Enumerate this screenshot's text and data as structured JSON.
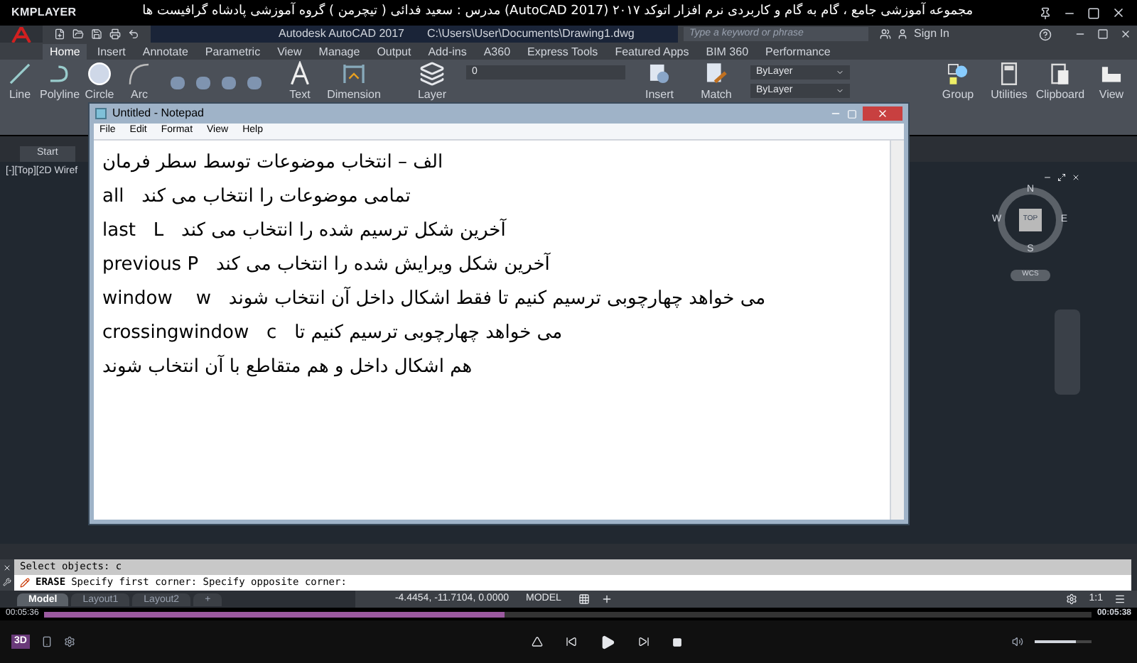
{
  "player": {
    "brand": "KMPLAYER",
    "title": "مجموعه آموزشی جامع ، گام به گام و کاربردی نرم افزار  اتوکد ۲۰۱۷ (AutoCAD 2017)  مدرس : سعید فدائی ( تیچرمن ) گروه آموزشی پادشاه گرافیست ها",
    "time_elapsed": "00:05:36",
    "time_total": "00:05:38",
    "progress": {
      "level": 0.44
    },
    "volume": {
      "level": 0.72
    },
    "badge": "3D"
  },
  "app": {
    "title": "Autodesk AutoCAD 2017",
    "path": "C:\\Users\\User\\Documents\\Drawing1.dwg",
    "search": {
      "placeholder": "Type a keyword or phrase"
    },
    "sign_in": "Sign In"
  },
  "ribbon_tabs": [
    {
      "label": "Home",
      "selected": true
    },
    {
      "label": "Insert",
      "selected": false
    },
    {
      "label": "Annotate",
      "selected": false
    },
    {
      "label": "Parametric",
      "selected": false
    },
    {
      "label": "View",
      "selected": false
    },
    {
      "label": "Manage",
      "selected": false
    },
    {
      "label": "Output",
      "selected": false
    },
    {
      "label": "Add-ins",
      "selected": false
    },
    {
      "label": "A360",
      "selected": false
    },
    {
      "label": "Express Tools",
      "selected": false
    },
    {
      "label": "Featured Apps",
      "selected": false
    },
    {
      "label": "BIM 360",
      "selected": false
    },
    {
      "label": "Performance",
      "selected": false
    }
  ],
  "ribbon_tools_left": [
    {
      "label": "Line",
      "kind": "line"
    },
    {
      "label": "Polyline",
      "kind": "polyline"
    },
    {
      "label": "Circle",
      "kind": "circle"
    },
    {
      "label": "Arc",
      "kind": "arc"
    }
  ],
  "ribbon_tools_mid": [
    {
      "label": "Text",
      "kind": "text"
    },
    {
      "label": "Dimension",
      "kind": "dimension"
    },
    {
      "label": "Layer",
      "kind": "layer"
    }
  ],
  "layer_value": "0",
  "ribbon_tools_right": [
    {
      "label": "Insert",
      "kind": "insert"
    },
    {
      "label": "Match",
      "kind": "match"
    }
  ],
  "properties": [
    "ByLayer",
    "ByLayer"
  ],
  "ribbon_tools_end": [
    {
      "label": "Group",
      "kind": "group"
    },
    {
      "label": "Utilities",
      "kind": "utilities"
    },
    {
      "label": "Clipboard",
      "kind": "clipboard"
    },
    {
      "label": "View",
      "kind": "view"
    }
  ],
  "file_tabs": [
    {
      "label": "Start",
      "selected": true
    }
  ],
  "viewport_label": "[-][Top][2D Wiref",
  "viewcube": {
    "top": "TOP",
    "north": "N",
    "south": "S",
    "east": "E",
    "west": "W",
    "ucs": "WCS"
  },
  "notepad": {
    "title": "Untitled - Notepad",
    "menu": [
      "File",
      "Edit",
      "Format",
      "View",
      "Help"
    ],
    "lines": [
      "الف – انتخاب موضوعات توسط سطر فرمان",
      "all   تمامی موضوعات را انتخاب می کند",
      "last   L   آخرین شکل ترسیم شده را انتخاب می کند",
      "previous P   آخرین شکل ویرایش شده را انتخاب می کند",
      "window    w   می خواهد چهارچوبی ترسیم کنیم تا فقط اشکال داخل آن انتخاب شوند",
      "crossingwindow   c   می خواهد چهارچوبی ترسیم کنیم تا",
      "هم اشکال داخل و هم متقاطع با آن انتخاب شوند"
    ]
  },
  "command": {
    "history": "Select objects: c",
    "command_name": "ERASE",
    "prompt": "Specify first corner: Specify opposite corner:"
  },
  "layout_tabs": [
    {
      "label": "Model",
      "selected": true
    },
    {
      "label": "Layout1",
      "selected": false
    },
    {
      "label": "Layout2",
      "selected": false
    },
    {
      "label": "+",
      "selected": false
    }
  ],
  "status": {
    "coordinates": "-4.4454, -11.7104, 0.0000",
    "space": "MODEL",
    "scale": "1:1"
  }
}
